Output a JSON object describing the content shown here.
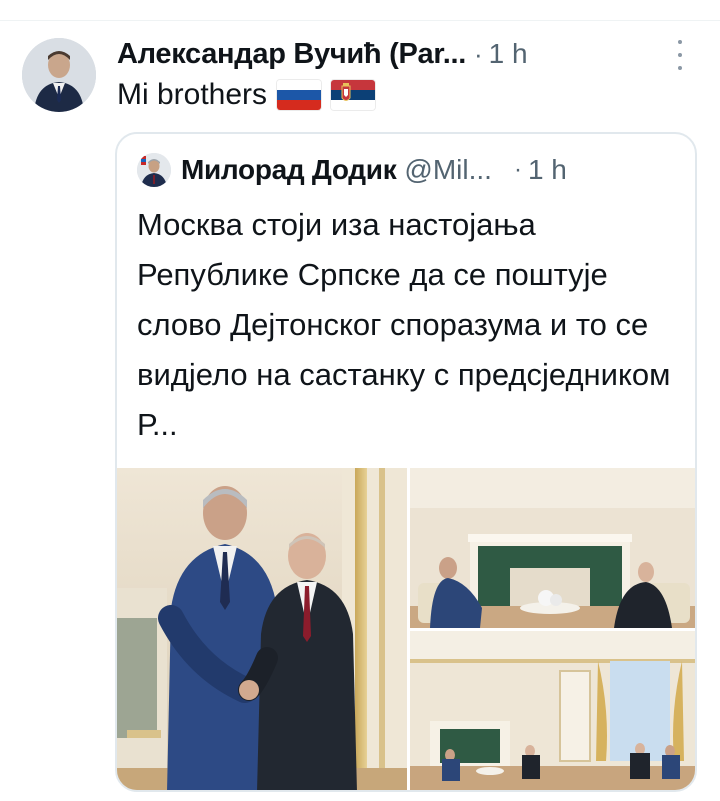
{
  "tweet": {
    "author_name": "Александар Вучић (Par...",
    "separator": "·",
    "time": "1 h",
    "text": "Mi brothers",
    "flags": [
      "russia-flag",
      "serbia-flag"
    ]
  },
  "quote": {
    "author_name": "Милорад Додик",
    "handle": "@Mil...",
    "separator": "·",
    "time": "1 h",
    "text": "Москва стоји иза настојања Републике Српске да се поштује слово Дејтонског споразума и то се видјело на састанку с предсједником Р..."
  },
  "colors": {
    "text_primary": "#0f1419",
    "text_secondary": "#536471",
    "card_border": "#e1e8ed"
  },
  "icons": [
    "more-options-icon"
  ]
}
